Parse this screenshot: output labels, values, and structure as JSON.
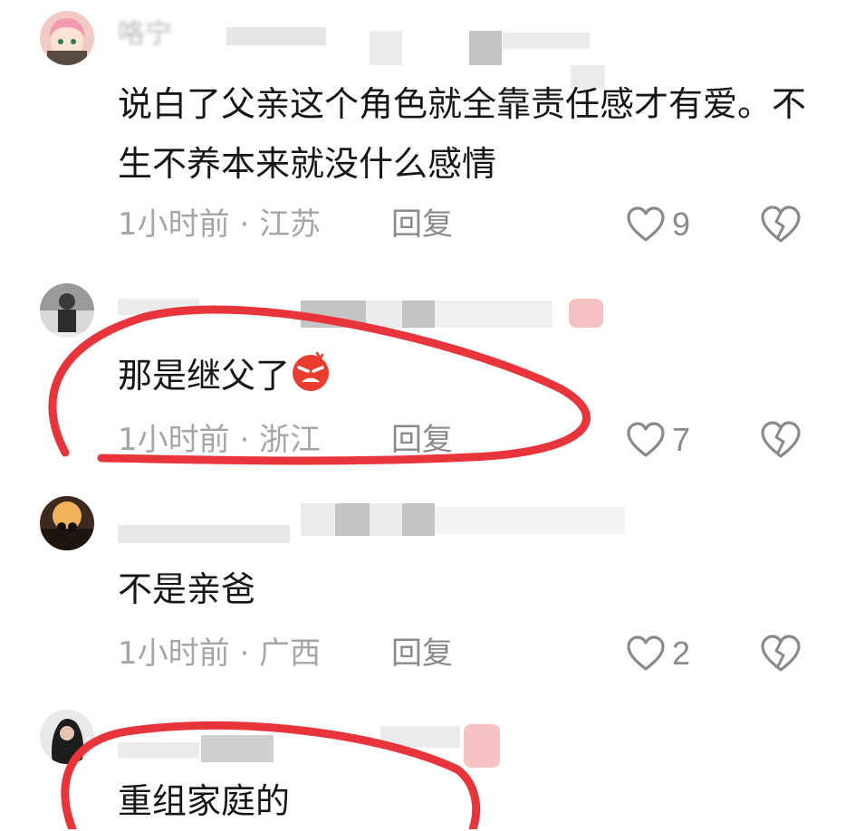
{
  "comments": [
    {
      "username": "咯宁",
      "text": "说白了父亲这个角色就全靠责任感才有爱。不生不养本来就没什么感情",
      "time_location": "1小时前 · 江苏",
      "reply_label": "回复",
      "likes": "9"
    },
    {
      "username": "",
      "text": "那是继父了",
      "emoji": "angry-face",
      "time_location": "1小时前 · 浙江",
      "reply_label": "回复",
      "likes": "7"
    },
    {
      "username": "",
      "text": "不是亲爸",
      "time_location": "1小时前 · 广西",
      "reply_label": "回复",
      "likes": "2"
    },
    {
      "username": "",
      "text": "重组家庭的"
    }
  ],
  "colors": {
    "annotation_red": "#e8353b",
    "meta_gray": "#a6a6a6",
    "icon_gray": "#8a8a8a"
  },
  "icons": {
    "like": "heart-outline-icon",
    "dislike": "broken-heart-icon"
  }
}
